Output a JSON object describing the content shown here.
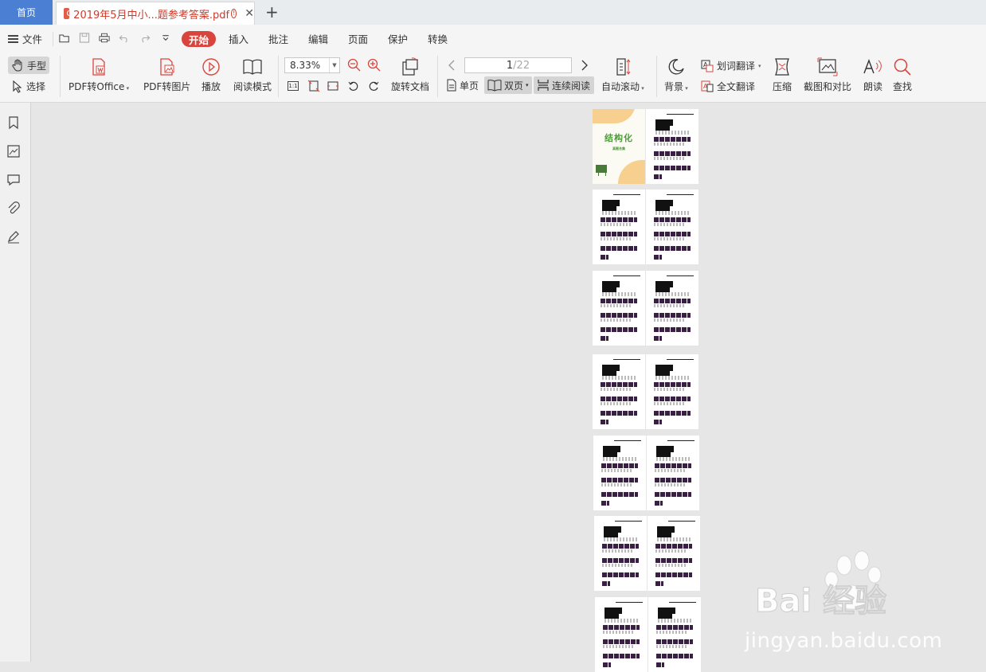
{
  "tabs": {
    "home": "首页",
    "document_title": "2019年5月中小...题参考答案.pdf",
    "warning_glyph": "!"
  },
  "menu": {
    "file": "文件",
    "items": [
      "开始",
      "插入",
      "批注",
      "编辑",
      "页面",
      "保护",
      "转换"
    ]
  },
  "toolbar": {
    "hand": "手型",
    "select": "选择",
    "pdf_to_office": "PDF转Office",
    "pdf_to_image": "PDF转图片",
    "play": "播放",
    "read_mode": "阅读模式",
    "zoom_value": "8.33%",
    "actual_size": "1:1",
    "rotate_doc": "旋转文档",
    "page_current": "1",
    "page_total": "/22",
    "single_page": "单页",
    "double_page": "双页",
    "continuous": "连续阅读",
    "auto_scroll": "自动滚动",
    "background": "背景",
    "word_translate": "划词翻译",
    "full_translate": "全文翻译",
    "compress": "压缩",
    "screenshot_compare": "截图和对比",
    "read_aloud": "朗读",
    "find": "查找"
  },
  "document": {
    "cover_title": "结构化",
    "cover_subtitle": "真题合集"
  },
  "watermark": {
    "brand": "Bai 经验",
    "url": "jingyan.baidu.com"
  },
  "colors": {
    "accent_red": "#d9453d",
    "home_tab_blue": "#4a7fd4",
    "cover_orange": "#f7cf8e",
    "cover_green": "#4f9a3c"
  }
}
